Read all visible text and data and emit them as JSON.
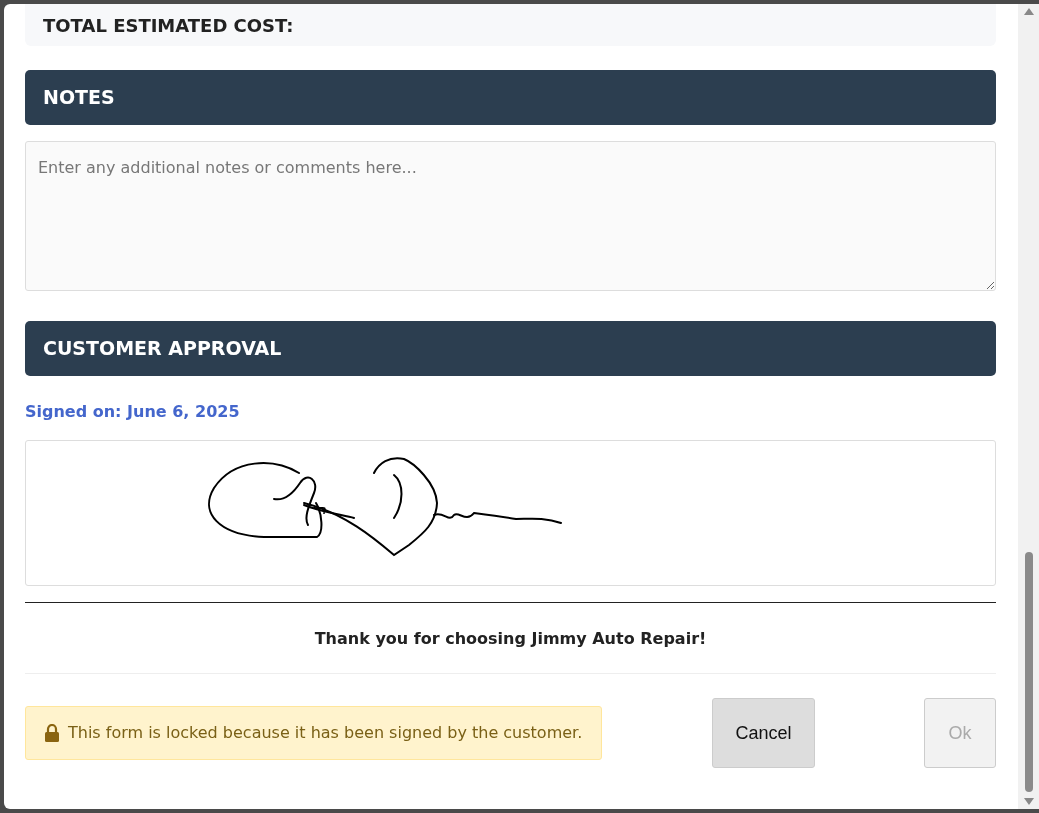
{
  "summary": {
    "label": "TOTAL ESTIMATED COST:"
  },
  "notes": {
    "title": "NOTES",
    "placeholder": "Enter any additional notes or comments here..."
  },
  "approval": {
    "title": "CUSTOMER APPROVAL",
    "signed_on": "Signed on: June 6, 2025",
    "signed": true
  },
  "thanks": "Thank you for choosing Jimmy Auto Repair!",
  "footer": {
    "locked": true,
    "lock_message": "This form is locked because it has been signed by the customer.",
    "buttons": [
      {
        "label": "Cancel",
        "disabled": false
      },
      {
        "label": "Ok",
        "disabled": true
      }
    ]
  }
}
